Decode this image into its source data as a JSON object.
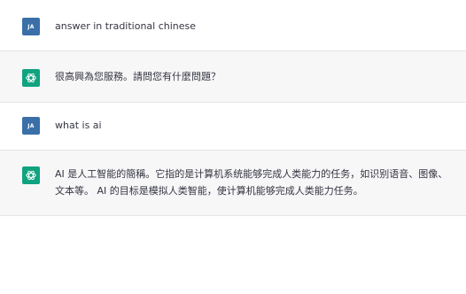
{
  "messages": [
    {
      "role": "user",
      "avatar_text": "JA",
      "text": "answer in traditional chinese"
    },
    {
      "role": "assistant",
      "avatar_icon": "chatgpt-logo-icon",
      "text": "很高興為您服務。請問您有什麼問題？"
    },
    {
      "role": "user",
      "avatar_text": "JA",
      "text": "what is ai"
    },
    {
      "role": "assistant",
      "avatar_icon": "chatgpt-logo-icon",
      "text": "AI 是人工智能的簡稱。它指的是计算机系统能够完成人类能力的任务，如识别语音、图像、文本等。 AI 的目标是模拟人类智能，使计算机能够完成人类能力任务。"
    }
  ],
  "colors": {
    "user_avatar_bg": "#3a6fa8",
    "assistant_avatar_bg": "#10a37f",
    "assistant_row_bg": "#f7f7f8"
  }
}
